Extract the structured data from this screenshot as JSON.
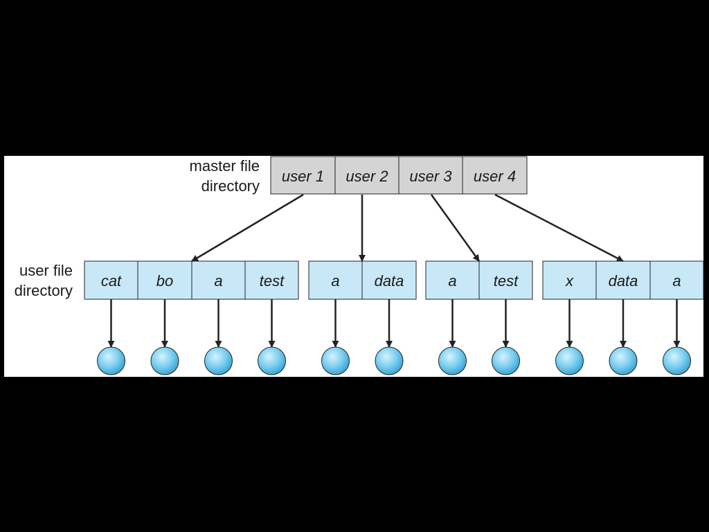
{
  "labels": {
    "master_line1": "master file",
    "master_line2": "directory",
    "user_line1": "user file",
    "user_line2": "directory"
  },
  "master_directory": [
    "user 1",
    "user 2",
    "user 3",
    "user 4"
  ],
  "user_directories": [
    {
      "owner": "user 1",
      "entries": [
        "cat",
        "bo",
        "a",
        "test"
      ]
    },
    {
      "owner": "user 2",
      "entries": [
        "a",
        "data"
      ]
    },
    {
      "owner": "user 3",
      "entries": [
        "a",
        "test"
      ]
    },
    {
      "owner": "user 4",
      "entries": [
        "x",
        "data",
        "a"
      ]
    }
  ],
  "colors": {
    "master_fill": "#d4d4d4",
    "user_fill": "#c8e8f8",
    "file_node": "#6cc6ec",
    "stroke": "#222222"
  }
}
